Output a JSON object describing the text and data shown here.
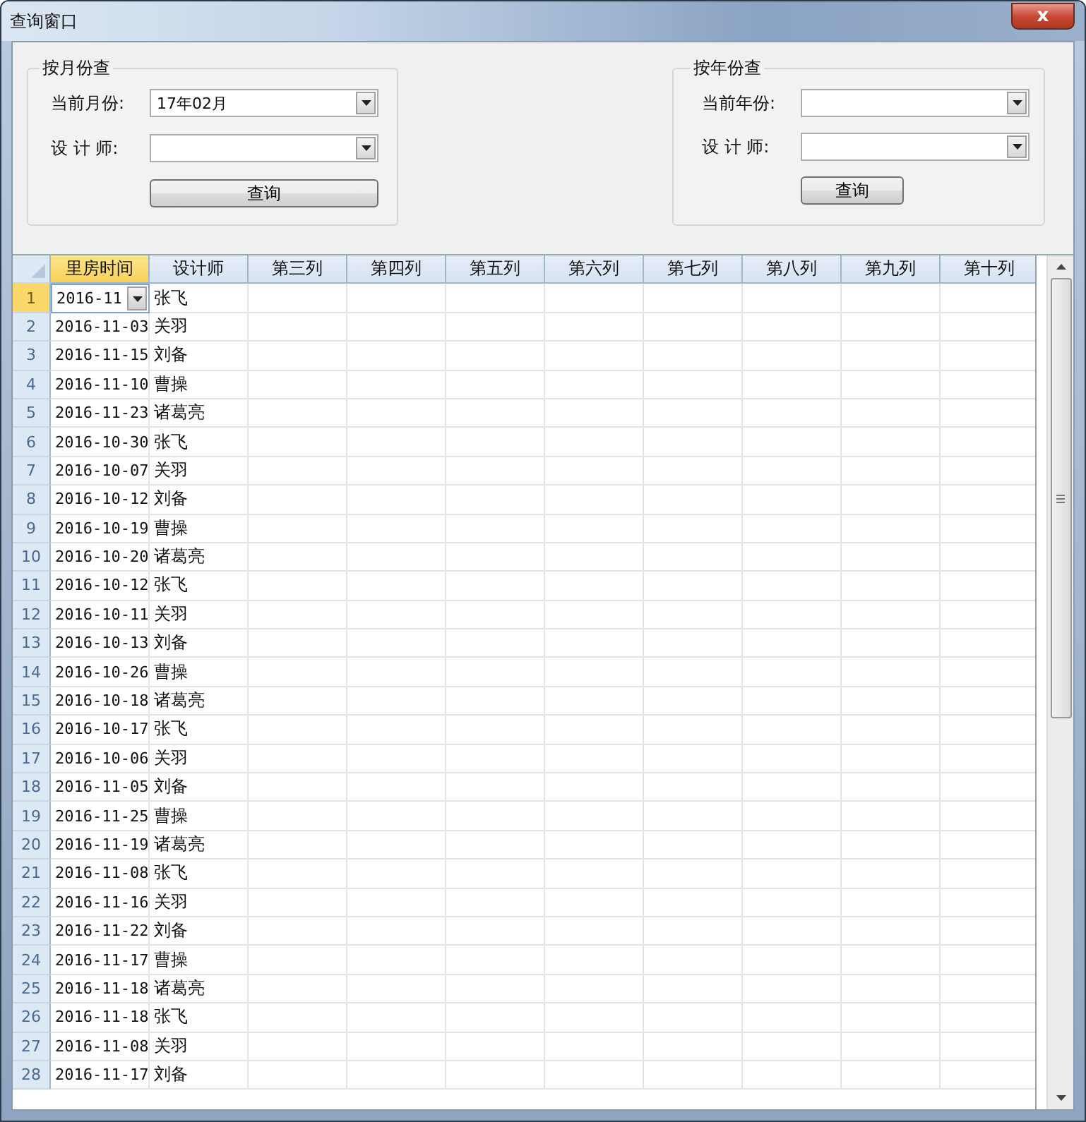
{
  "window": {
    "title": "查询窗口",
    "close": "x"
  },
  "groups": [
    {
      "title": "按月份查",
      "fields": [
        {
          "label": "当前月份:",
          "value": "17年02月"
        },
        {
          "label": "设 计 师:"
        }
      ],
      "button": "查询"
    },
    {
      "title": "按年份查",
      "fields": [
        {
          "label": "当前年份:"
        },
        {
          "label": "设 计 师:"
        }
      ],
      "button": "查询"
    }
  ],
  "grid": {
    "columns": [
      {
        "label": "里房时间",
        "selected": true
      },
      {
        "label": "设计师",
        "selected": false
      },
      {
        "label": "第三列",
        "selected": false
      },
      {
        "label": "第四列",
        "selected": false
      },
      {
        "label": "第五列",
        "selected": false
      },
      {
        "label": "第六列",
        "selected": false
      },
      {
        "label": "第七列",
        "selected": false
      },
      {
        "label": "第八列",
        "selected": false
      },
      {
        "label": "第九列",
        "selected": false
      },
      {
        "label": "第十列",
        "selected": false
      }
    ],
    "rows": [
      {
        "number": "1",
        "selected": true,
        "editing": true,
        "date": "2016-11",
        "designer": "张飞"
      },
      {
        "number": "2",
        "selected": false,
        "editing": false,
        "date": "2016-11-03",
        "designer": "关羽"
      },
      {
        "number": "3",
        "selected": false,
        "editing": false,
        "date": "2016-11-15",
        "designer": "刘备"
      },
      {
        "number": "4",
        "selected": false,
        "editing": false,
        "date": "2016-11-10",
        "designer": "曹操"
      },
      {
        "number": "5",
        "selected": false,
        "editing": false,
        "date": "2016-11-23",
        "designer": "诸葛亮"
      },
      {
        "number": "6",
        "selected": false,
        "editing": false,
        "date": "2016-10-30",
        "designer": "张飞"
      },
      {
        "number": "7",
        "selected": false,
        "editing": false,
        "date": "2016-10-07",
        "designer": "关羽"
      },
      {
        "number": "8",
        "selected": false,
        "editing": false,
        "date": "2016-10-12",
        "designer": "刘备"
      },
      {
        "number": "9",
        "selected": false,
        "editing": false,
        "date": "2016-10-19",
        "designer": "曹操"
      },
      {
        "number": "10",
        "selected": false,
        "editing": false,
        "date": "2016-10-20",
        "designer": "诸葛亮"
      },
      {
        "number": "11",
        "selected": false,
        "editing": false,
        "date": "2016-10-12",
        "designer": "张飞"
      },
      {
        "number": "12",
        "selected": false,
        "editing": false,
        "date": "2016-10-11",
        "designer": "关羽"
      },
      {
        "number": "13",
        "selected": false,
        "editing": false,
        "date": "2016-10-13",
        "designer": "刘备"
      },
      {
        "number": "14",
        "selected": false,
        "editing": false,
        "date": "2016-10-26",
        "designer": "曹操"
      },
      {
        "number": "15",
        "selected": false,
        "editing": false,
        "date": "2016-10-18",
        "designer": "诸葛亮"
      },
      {
        "number": "16",
        "selected": false,
        "editing": false,
        "date": "2016-10-17",
        "designer": "张飞"
      },
      {
        "number": "17",
        "selected": false,
        "editing": false,
        "date": "2016-10-06",
        "designer": "关羽"
      },
      {
        "number": "18",
        "selected": false,
        "editing": false,
        "date": "2016-11-05",
        "designer": "刘备"
      },
      {
        "number": "19",
        "selected": false,
        "editing": false,
        "date": "2016-11-25",
        "designer": "曹操"
      },
      {
        "number": "20",
        "selected": false,
        "editing": false,
        "date": "2016-11-19",
        "designer": "诸葛亮"
      },
      {
        "number": "21",
        "selected": false,
        "editing": false,
        "date": "2016-11-08",
        "designer": "张飞"
      },
      {
        "number": "22",
        "selected": false,
        "editing": false,
        "date": "2016-11-16",
        "designer": "关羽"
      },
      {
        "number": "23",
        "selected": false,
        "editing": false,
        "date": "2016-11-22",
        "designer": "刘备"
      },
      {
        "number": "24",
        "selected": false,
        "editing": false,
        "date": "2016-11-17",
        "designer": "曹操"
      },
      {
        "number": "25",
        "selected": false,
        "editing": false,
        "date": "2016-11-18",
        "designer": "诸葛亮"
      },
      {
        "number": "26",
        "selected": false,
        "editing": false,
        "date": "2016-11-18",
        "designer": "张飞"
      },
      {
        "number": "27",
        "selected": false,
        "editing": false,
        "date": "2016-11-08",
        "designer": "关羽"
      },
      {
        "number": "28",
        "selected": false,
        "editing": false,
        "date": "2016-11-17",
        "designer": "刘备"
      }
    ]
  }
}
